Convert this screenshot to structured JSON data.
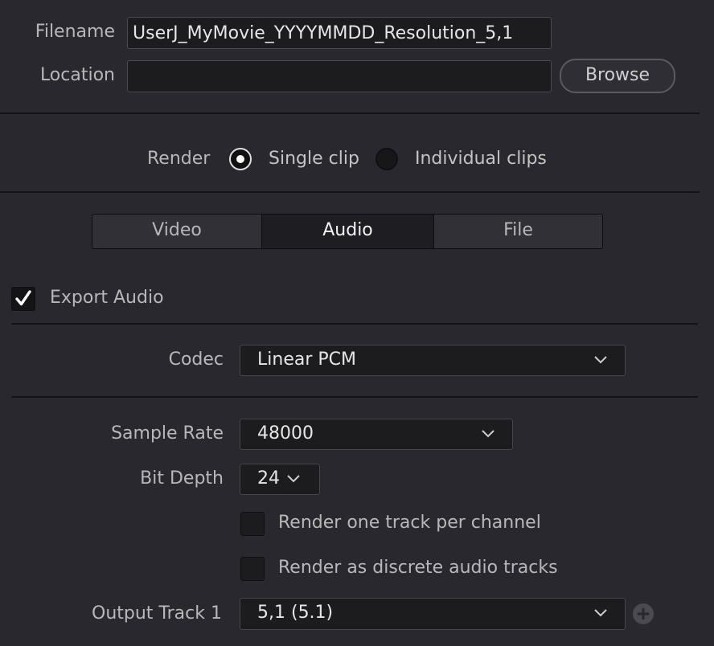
{
  "file": {
    "filename_label": "Filename",
    "filename_value": "UserJ_MyMovie_YYYYMMDD_Resolution_5,1",
    "location_label": "Location",
    "location_value": "",
    "browse_label": "Browse"
  },
  "render": {
    "label": "Render",
    "options": [
      "Single clip",
      "Individual clips"
    ],
    "selected": "Single clip"
  },
  "tabs": {
    "items": [
      "Video",
      "Audio",
      "File"
    ],
    "active": "Audio"
  },
  "audio": {
    "export_label": "Export Audio",
    "export_checked": true,
    "codec_label": "Codec",
    "codec_value": "Linear PCM",
    "sample_rate_label": "Sample Rate",
    "sample_rate_value": "48000",
    "bit_depth_label": "Bit Depth",
    "bit_depth_value": "24",
    "one_track_label": "Render one track per channel",
    "one_track_checked": false,
    "discrete_label": "Render as discrete audio tracks",
    "discrete_checked": false,
    "output_track_label": "Output Track 1",
    "output_track_value": "5,1 (5.1)"
  },
  "icons": {
    "chevron": "chevron-down-icon",
    "check": "checkmark-icon",
    "add": "plus-icon"
  },
  "colors": {
    "background": "#28282e",
    "field": "#1c1c1f",
    "active_tab": "#1e1e22"
  }
}
